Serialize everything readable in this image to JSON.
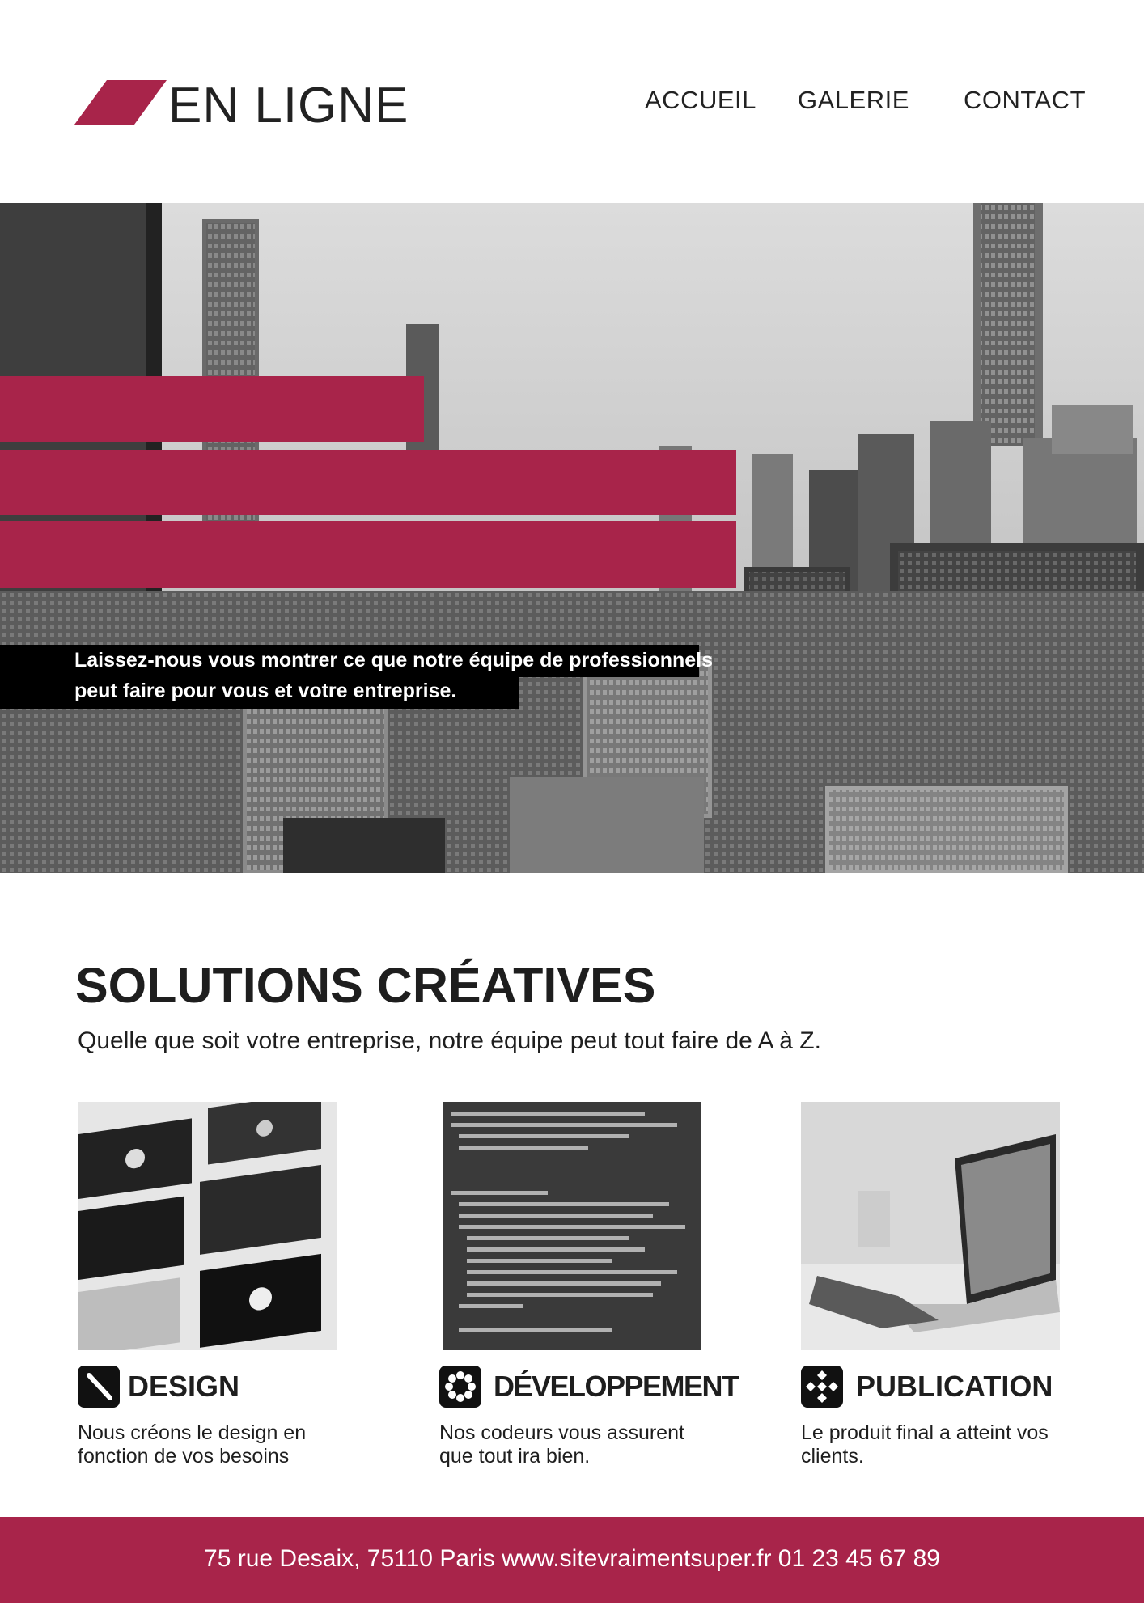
{
  "header": {
    "logo_text": "EN LIGNE",
    "nav": [
      "ACCUEIL",
      "GALERIE",
      "CONTACT"
    ]
  },
  "hero": {
    "tagline": "Laissez-nous vous montrer ce que notre équipe de professionnels peut faire pour vous et votre entreprise."
  },
  "section": {
    "title": "SOLUTIONS CRÉATIVES",
    "subtitle": "Quelle que soit votre entreprise, notre équipe peut tout faire de A à Z."
  },
  "cards": [
    {
      "title": "DESIGN",
      "text": "Nous créons le design en fonction de vos besoins",
      "icon": "pen-icon"
    },
    {
      "title": "DÉVELOPPEMENT",
      "text": "Nos codeurs vous assurent que tout ira bien.",
      "icon": "gear-icon"
    },
    {
      "title": "PUBLICATION",
      "text": "Le produit final a atteint vos clients.",
      "icon": "diamond-grid-icon"
    }
  ],
  "footer": {
    "text": "75 rue Desaix, 75110 Paris www.sitevraimentsuper.fr 01 23 45 67 89"
  },
  "colors": {
    "accent": "#a8244a",
    "text": "#1e1e1e"
  }
}
